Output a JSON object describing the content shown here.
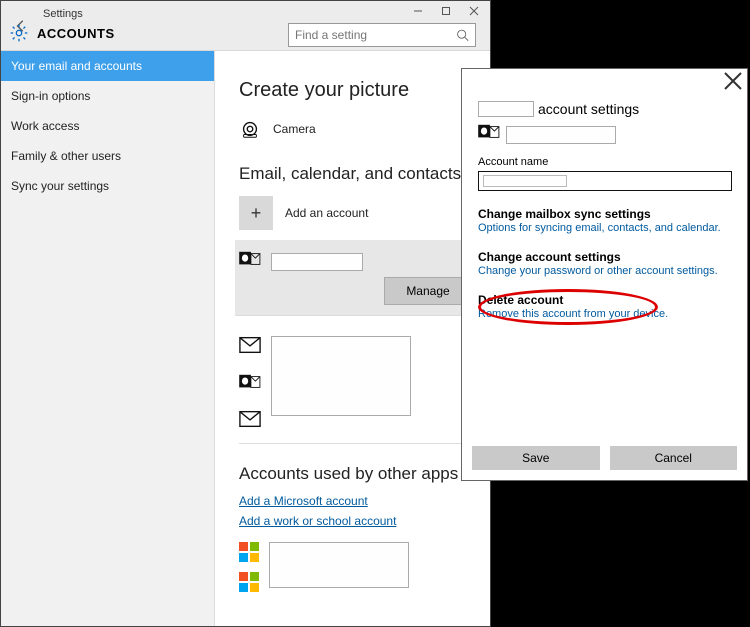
{
  "titlebar": {
    "title": "Settings"
  },
  "header": {
    "label": "ACCOUNTS",
    "search_placeholder": "Find a setting"
  },
  "sidebar": {
    "items": [
      {
        "label": "Your email and accounts",
        "selected": true
      },
      {
        "label": "Sign-in options",
        "selected": false
      },
      {
        "label": "Work access",
        "selected": false
      },
      {
        "label": "Family & other users",
        "selected": false
      },
      {
        "label": "Sync your settings",
        "selected": false
      }
    ]
  },
  "content": {
    "picture_heading": "Create your picture",
    "camera_label": "Camera",
    "email_heading": "Email, calendar, and contacts",
    "add_account_label": "Add an account",
    "manage_label": "Manage",
    "other_apps_heading": "Accounts used by other apps",
    "add_ms_link": "Add a Microsoft account",
    "add_work_link": "Add a work or school account"
  },
  "dialog": {
    "title_suffix": "account settings",
    "account_name_label": "Account name",
    "sections": [
      {
        "title": "Change mailbox sync settings",
        "subtitle": "Options for syncing email, contacts, and calendar."
      },
      {
        "title": "Change account settings",
        "subtitle": "Change your password or other account settings."
      },
      {
        "title": "Delete account",
        "subtitle": "Remove this account from your device."
      }
    ],
    "save_label": "Save",
    "cancel_label": "Cancel"
  }
}
